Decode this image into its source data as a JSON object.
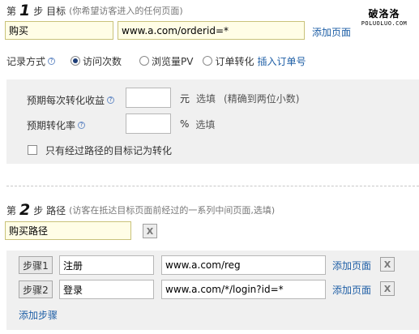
{
  "step1": {
    "prefix": "第",
    "number": "1",
    "label": "步 目标",
    "hint": "(你希望访客进入的任何页面)"
  },
  "goal": {
    "name_value": "购买",
    "url_value": "www.a.com/orderid=*",
    "add_page_label": "添加页面"
  },
  "watermark": {
    "cn": "破洛洛",
    "en": "POLUOLUO.COM"
  },
  "record": {
    "label": "记录方式",
    "help_icon": "question-icon",
    "options": [
      "访问次数",
      "浏览量PV",
      "订单转化"
    ],
    "selected_index": 0,
    "insert_order_label": "插入订单号"
  },
  "conversion": {
    "value_label": "预期每次转化收益",
    "value_unit": "元",
    "value_optional": "选填",
    "value_note": "(精确到两位小数)",
    "rate_label": "预期转化率",
    "rate_unit": "%",
    "rate_optional": "选填",
    "path_only_label": "只有经过路径的目标记为转化",
    "path_only_checked": false
  },
  "step2": {
    "prefix": "第",
    "number": "2",
    "label": "步 路径",
    "hint": "(访客在抵达目标页面前经过的一系列中间页面,选填)"
  },
  "path": {
    "name_value": "购买路径",
    "remove_label": "X",
    "steps": [
      {
        "button": "步骤1",
        "name": "注册",
        "url": "www.a.com/reg",
        "add_page": "添加页面",
        "remove": "X"
      },
      {
        "button": "步骤2",
        "name": "登录",
        "url": "www.a.com/*/login?id=*",
        "add_page": "添加页面",
        "remove": "X"
      }
    ],
    "add_step_label": "添加步骤"
  }
}
